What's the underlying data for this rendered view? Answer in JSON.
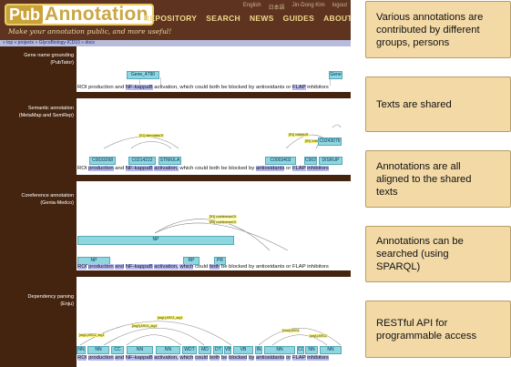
{
  "header": {
    "logo_pub": "Pub",
    "logo_ann": "Annotation",
    "tagline": "Make your annotation public, and more useful!",
    "nav": [
      "REPOSITORY",
      "SEARCH",
      "NEWS",
      "GUIDES",
      "ABOUT"
    ],
    "util": [
      "English",
      "日本語",
      "Jin-Dong Kim",
      "logout"
    ],
    "breadcrumb": "» top » projects » GlycoBiology-ICD10 » docs"
  },
  "sections": [
    {
      "label_line1": "Gene name grounding",
      "label_line2": "(PubTator)"
    },
    {
      "label_line1": "Semantic annotation",
      "label_line2": "(MetaMap and SemRep)"
    },
    {
      "label_line1": "Coreference annotation",
      "label_line2": "(Genia-Medco)"
    },
    {
      "label_line1": "Dependency parsing",
      "label_line2": "(Enju)"
    }
  ],
  "sentence": {
    "w1": "ROI",
    "w2": "production",
    "w3": "and",
    "w4": "NF-kappaB",
    "w5": "activation,",
    "w6": "which",
    "w7": "could",
    "w8": "both",
    "w9": "be",
    "w10": "blocked",
    "w11": "by",
    "w12": "antioxidants",
    "w13": "or",
    "w14": "FLAP",
    "w15": "inhibitors"
  },
  "gene_labels": {
    "g1": "Gene_4790",
    "g2": "Gene"
  },
  "semantic_labels": {
    "s1": "C0033268",
    "s2": "C0214222",
    "s3": "STIMULA",
    "s4": "C0003402",
    "s5": "C002",
    "s6": "DISRUP",
    "s7": "C0243076",
    "r1": "[S1] stimulatesOf",
    "r2": "[R1] inhibitsOf",
    "r3": "[R2] inhibitsOf"
  },
  "coref_labels": {
    "c_np_big": "NP",
    "c_np_small": "NP",
    "c_rp": "RP",
    "c_pr": "PR",
    "r1": "[R1] coreferenceOf",
    "r2": "[R6] coreferenceOf"
  },
  "dep_labels": {
    "tags": [
      "NN",
      "NN",
      "CC",
      "NN",
      "NN",
      "WDT",
      "MD",
      "DT",
      "VB",
      "VB",
      "IN",
      "NN",
      "CC",
      "NN",
      "NN"
    ],
    "rels": [
      "[arg1] ARG1_arg1",
      "[arg2] ARG1_arg2",
      "[arg1] ARG2_arg1",
      "[mod] ARG1",
      "[arg1] ARG2"
    ]
  },
  "callouts": [
    [
      "Various annotations are",
      "contributed by different",
      "groups, persons"
    ],
    [
      "Texts are shared"
    ],
    [
      "Annotations are all",
      "aligned to the shared",
      "texts"
    ],
    [
      "Annotations can be",
      "searched (using",
      "SPARQL)"
    ],
    [
      "RESTful API for",
      "programmable access"
    ]
  ]
}
